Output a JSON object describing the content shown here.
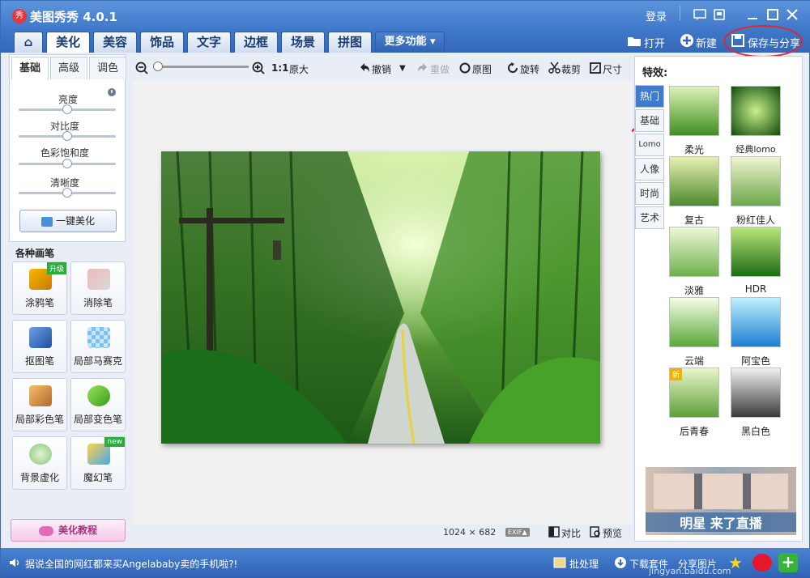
{
  "window": {
    "title": "美图秀秀 4.0.1",
    "logo_text": "秀",
    "login": "登录"
  },
  "tabs": [
    {
      "label": "⌂"
    },
    {
      "label": "美化"
    },
    {
      "label": "美容"
    },
    {
      "label": "饰品"
    },
    {
      "label": "文字"
    },
    {
      "label": "边框"
    },
    {
      "label": "场景"
    },
    {
      "label": "拼图"
    },
    {
      "label": "更多功能 ▾"
    }
  ],
  "top_actions": {
    "open": "打开",
    "new": "新建",
    "save_share": "保存与分享"
  },
  "adjust": {
    "tabs": [
      "基础",
      "高级",
      "调色"
    ],
    "sliders": [
      {
        "label": "亮度",
        "value": 0.5
      },
      {
        "label": "对比度",
        "value": 0.5
      },
      {
        "label": "色彩饱和度",
        "value": 0.5
      },
      {
        "label": "清晰度",
        "value": 0.5
      }
    ],
    "one_click": "一键美化"
  },
  "brushes": {
    "title": "各种画笔",
    "items": [
      {
        "label": "涂鸦笔",
        "badge": "升级"
      },
      {
        "label": "消除笔"
      },
      {
        "label": "抠图笔"
      },
      {
        "label": "局部马赛克"
      },
      {
        "label": "局部彩色笔"
      },
      {
        "label": "局部变色笔"
      },
      {
        "label": "背景虚化"
      },
      {
        "label": "魔幻笔",
        "badge": "new"
      }
    ]
  },
  "tutorial": "美化教程",
  "toolbar": {
    "zoom_ratio": "1:1",
    "original_size": "原大",
    "undo": "撤销",
    "redo": "重做",
    "original": "原图",
    "rotate": "旋转",
    "crop": "裁剪",
    "size": "尺寸"
  },
  "canvas_info": {
    "dims": "1024 × 682",
    "exif": "EXIF▲",
    "compare": "对比",
    "preview": "预览"
  },
  "effects": {
    "title": "特效:",
    "categories": [
      "热门",
      "基础",
      "Lomo",
      "人像",
      "时尚",
      "艺术"
    ],
    "items": [
      {
        "label": "柔光"
      },
      {
        "label": "经典lomo"
      },
      {
        "label": "复古"
      },
      {
        "label": "粉红佳人"
      },
      {
        "label": "淡雅"
      },
      {
        "label": "HDR"
      },
      {
        "label": "云端"
      },
      {
        "label": "阿宝色"
      },
      {
        "label": "后青春",
        "badge": "新"
      },
      {
        "label": "黑白色"
      }
    ]
  },
  "ad": {
    "text": "明星 来了直播"
  },
  "status": {
    "marquee": "据说全国的网红都来买Angelababy卖的手机啦?!",
    "batch": "批处理",
    "download": "下载套件",
    "share_pic": "分享图片",
    "url": "jingyan.baidu.com"
  }
}
